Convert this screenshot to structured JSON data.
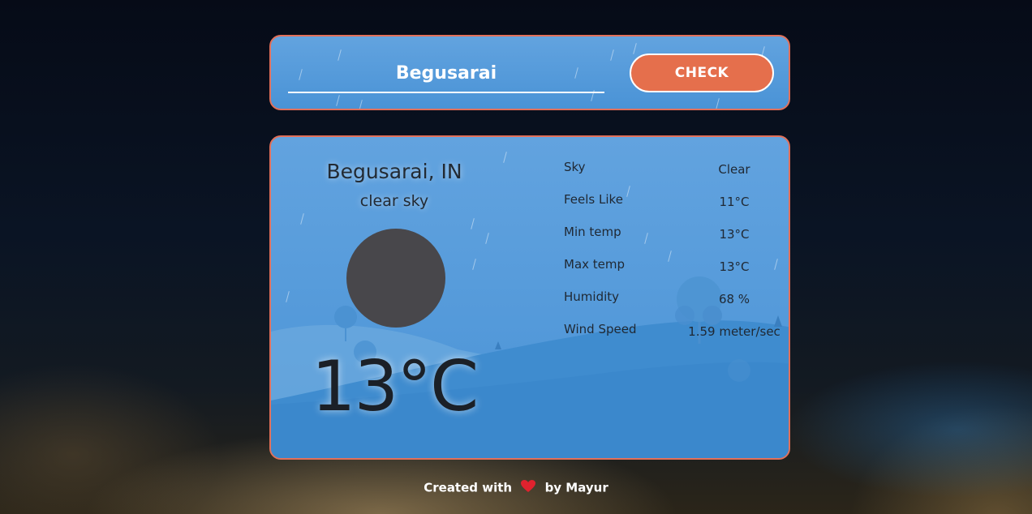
{
  "search": {
    "city_value": "Begusarai",
    "check_label": "CHECK"
  },
  "weather": {
    "location": "Begusarai, IN",
    "description": "clear sky",
    "icon": "weather-icon-placeholder",
    "temperature": "13°C",
    "stats": [
      {
        "label": "Sky",
        "value": "Clear"
      },
      {
        "label": "Feels Like",
        "value": "11°C"
      },
      {
        "label": "Min temp",
        "value": "13°C"
      },
      {
        "label": "Max temp",
        "value": "13°C"
      },
      {
        "label": "Humidity",
        "value": "68 %"
      },
      {
        "label": "Wind Speed",
        "value": "1.59 meter/sec"
      }
    ]
  },
  "footer": {
    "prefix": "Created with",
    "suffix": "by Mayur",
    "icon": "heart-icon"
  },
  "colors": {
    "card_bg": "#5a9edc",
    "card_border": "#e2705a",
    "button_bg": "#e56f4c",
    "heart": "#e0222e"
  }
}
